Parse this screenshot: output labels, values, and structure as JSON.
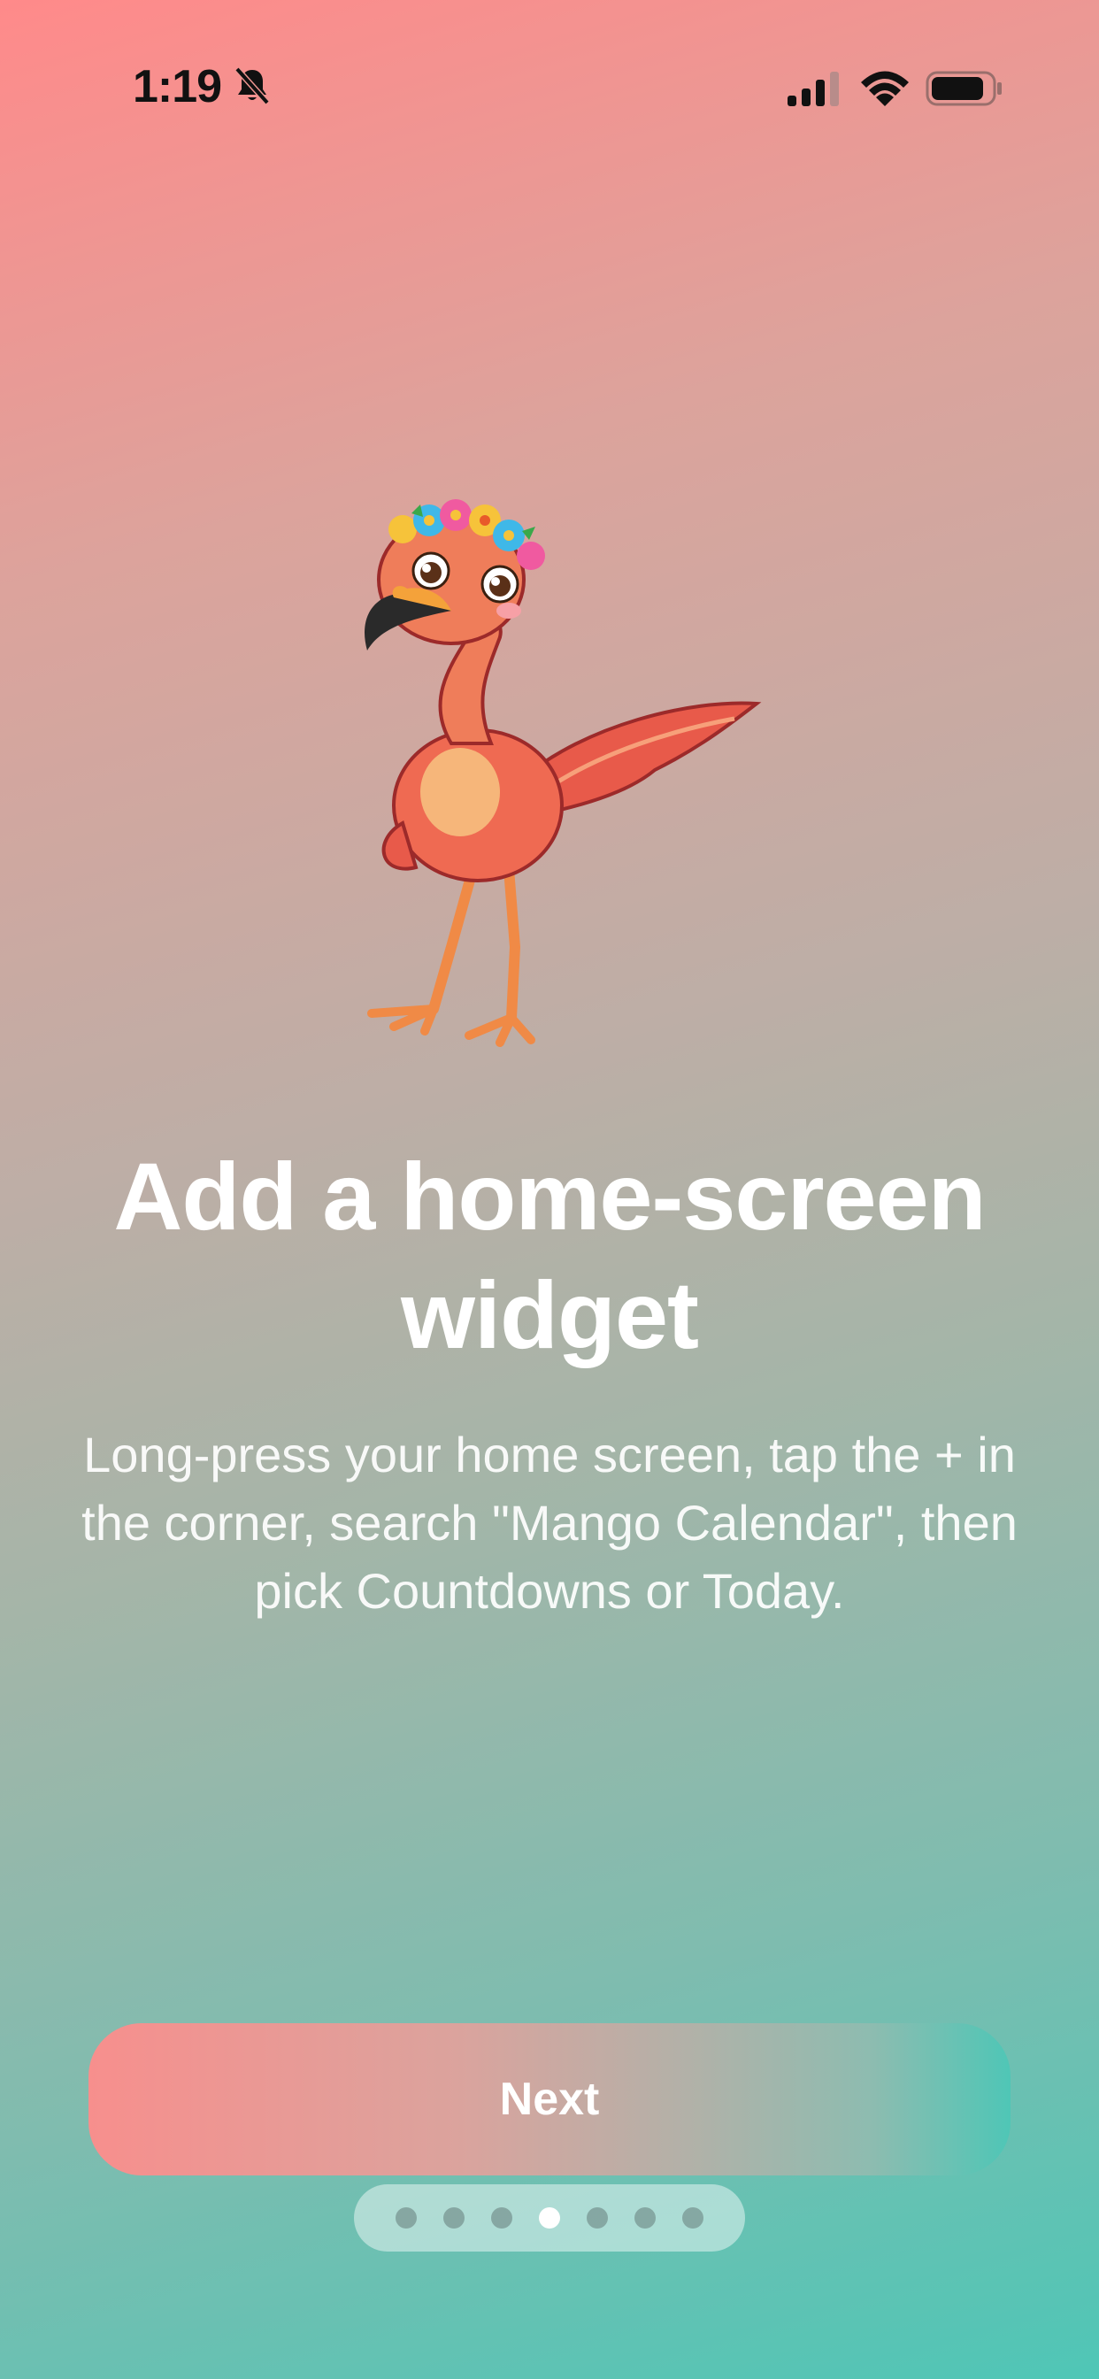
{
  "status_bar": {
    "time": "1:19",
    "icons": [
      "bell-slash-icon",
      "cellular-signal-icon",
      "wifi-icon",
      "battery-icon"
    ]
  },
  "illustration": {
    "icon": "flamingo-mascot-illustration"
  },
  "onboarding": {
    "title": "Add a home-screen widget",
    "description": "Long-press your home screen, tap the + in the corner, search \"Mango Calendar\", then pick Countdowns or Today."
  },
  "next_button": {
    "label": "Next"
  },
  "page_indicator": {
    "total": 7,
    "current": 4
  },
  "colors": {
    "gradient_top": "#ff8a8a",
    "gradient_bottom": "#4fc6b6",
    "text": "#ffffff"
  }
}
